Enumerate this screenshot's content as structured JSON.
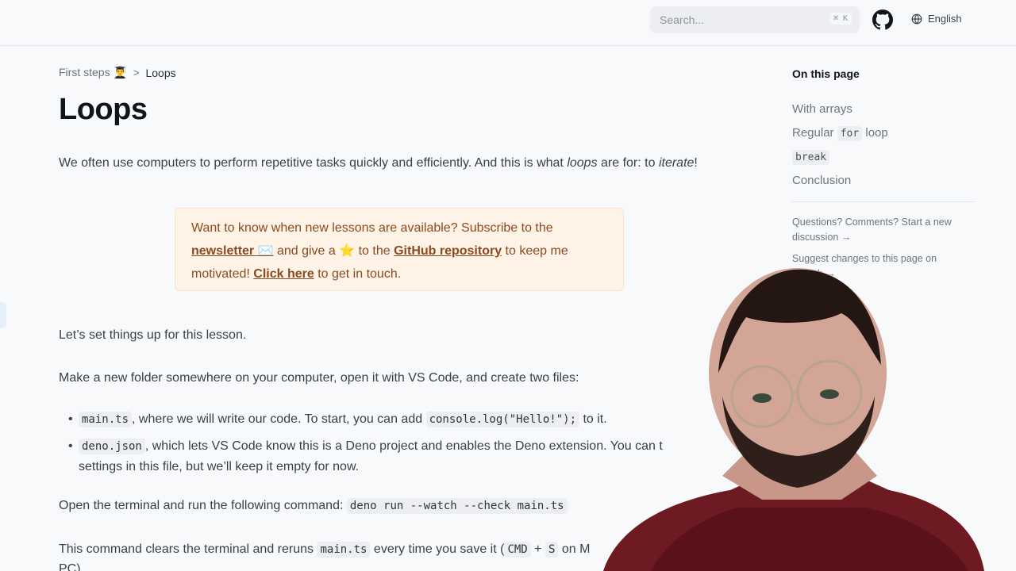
{
  "header": {
    "search_placeholder": "Search...",
    "search_shortcut": "⌘ K",
    "language": "English"
  },
  "breadcrumb": {
    "first": "First steps 👨‍🎓",
    "current": "Loops"
  },
  "title": "Loops",
  "intro": {
    "before": "We often use computers to perform repetitive tasks quickly and efficiently. And this is what ",
    "loops": "loops",
    "middle": " are for: to ",
    "iterate": "iterate",
    "after": "!"
  },
  "callout": {
    "line1": "Want to know when new lessons are available? Subscribe to the",
    "newsletter": "newsletter ✉️",
    "give": " and give a ⭐ to the ",
    "github_repo": "GitHub repository",
    "keep": " to keep me",
    "motivated": "motivated! ",
    "click_here": "Click here",
    "touch": " to get in touch."
  },
  "setup": "Let’s set things up for this lesson.",
  "folder": "Make a new folder somewhere on your computer, open it with VS Code, and create two files:",
  "bullets": {
    "b1_code": "main.ts",
    "b1_text": ", where we will write our code. To start, you can add ",
    "b1_code2": "console.log(\"Hello!\");",
    "b1_end": " to it.",
    "b2_code": "deno.json",
    "b2_text": ", which lets VS Code know this is a Deno project and enables the Deno extension. You can t",
    "b2_line2": "settings in this file, but we’ll keep it empty for now."
  },
  "terminal": {
    "text": "Open the terminal and run the following command: ",
    "command": "deno run --watch --check main.ts"
  },
  "rerun": {
    "before": "This command clears the terminal and reruns ",
    "file": "main.ts",
    "middle": " every time you save it (",
    "key1": "CMD",
    "plus": " + ",
    "key2": "S",
    "after": " on M",
    "line2": "PC)."
  },
  "toc": {
    "title": "On this page",
    "items": {
      "arrays": "With arrays",
      "regular_before": "Regular ",
      "regular_code": "for",
      "regular_after": " loop",
      "break": "break",
      "conclusion": "Conclusion"
    },
    "questions": "Questions? Comments? Start a new discussion →",
    "suggest": "Suggest changes to this page on GitHub →"
  }
}
